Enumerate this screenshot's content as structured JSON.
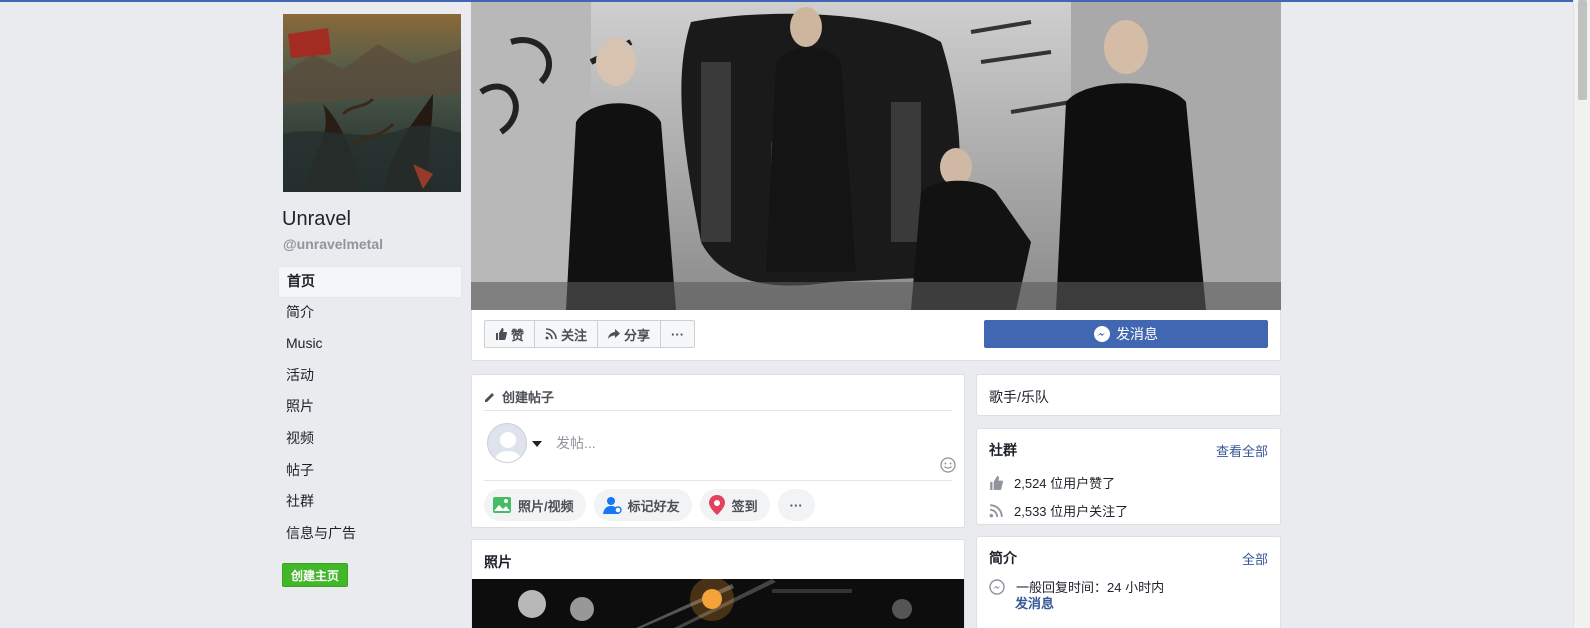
{
  "page": {
    "name": "Unravel",
    "handle": "@unravelmetal"
  },
  "nav": {
    "items": [
      {
        "label": "首页",
        "active": true
      },
      {
        "label": "简介"
      },
      {
        "label": "Music"
      },
      {
        "label": "活动"
      },
      {
        "label": "照片"
      },
      {
        "label": "视频"
      },
      {
        "label": "帖子"
      },
      {
        "label": "社群"
      },
      {
        "label": "信息与广告"
      }
    ],
    "create_page_label": "创建主页"
  },
  "actions": {
    "like_label": "赞",
    "follow_label": "关注",
    "share_label": "分享",
    "more_label": "···",
    "message_label": "发消息"
  },
  "composer": {
    "title": "创建帖子",
    "placeholder": "发帖...",
    "photo_video_label": "照片/视频",
    "tag_friends_label": "标记好友",
    "checkin_label": "签到",
    "more_label": "···"
  },
  "photos": {
    "title": "照片"
  },
  "sidebar": {
    "category": "歌手/乐队",
    "community": {
      "title": "社群",
      "see_all_label": "查看全部",
      "likes_text": "2,524 位用户赞了",
      "follows_text": "2,533 位用户关注了"
    },
    "about": {
      "title": "简介",
      "all_label": "全部",
      "response_text": "一般回复时间：24 小时内",
      "message_link": "发消息"
    }
  },
  "colors": {
    "brand_blue": "#4267b2",
    "link_blue": "#365899",
    "create_green": "#42b72a",
    "background": "#e9ebee"
  }
}
